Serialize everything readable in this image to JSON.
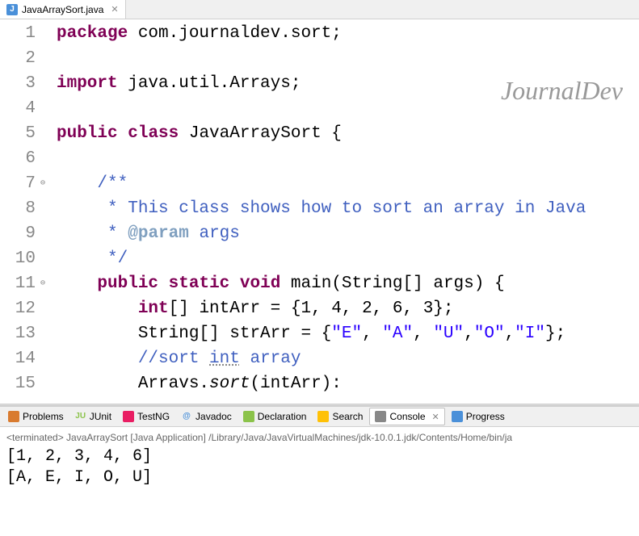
{
  "tab": {
    "filename": "JavaArraySort.java"
  },
  "watermark": "JournalDev",
  "code": {
    "lines": [
      {
        "num": "1",
        "raw": "package com.journaldev.sort;",
        "tokens": [
          [
            "kw",
            "package"
          ],
          [
            "plain",
            " com.journaldev.sort;"
          ]
        ]
      },
      {
        "num": "2",
        "raw": "",
        "tokens": []
      },
      {
        "num": "3",
        "raw": "import java.util.Arrays;",
        "tokens": [
          [
            "kw",
            "import"
          ],
          [
            "plain",
            " java.util.Arrays;"
          ]
        ]
      },
      {
        "num": "4",
        "raw": "",
        "tokens": []
      },
      {
        "num": "5",
        "raw": "public class JavaArraySort {",
        "tokens": [
          [
            "kw",
            "public"
          ],
          [
            "plain",
            " "
          ],
          [
            "kw",
            "class"
          ],
          [
            "plain",
            " JavaArraySort {"
          ]
        ]
      },
      {
        "num": "6",
        "raw": "",
        "highlight": true,
        "tokens": []
      },
      {
        "num": "7",
        "raw": "    /**",
        "fold": true,
        "tokens": [
          [
            "plain",
            "    "
          ],
          [
            "comment",
            "/**"
          ]
        ]
      },
      {
        "num": "8",
        "raw": "     * This class shows how to sort an array in Java",
        "tokens": [
          [
            "plain",
            "     "
          ],
          [
            "comment",
            "* This class shows how to sort an array in Java"
          ]
        ]
      },
      {
        "num": "9",
        "raw": "     * @param args",
        "tokens": [
          [
            "plain",
            "     "
          ],
          [
            "comment",
            "* "
          ],
          [
            "tag",
            "@param"
          ],
          [
            "comment",
            " args"
          ]
        ]
      },
      {
        "num": "10",
        "raw": "     */",
        "tokens": [
          [
            "plain",
            "     "
          ],
          [
            "comment",
            "*/"
          ]
        ]
      },
      {
        "num": "11",
        "raw": "    public static void main(String[] args) {",
        "fold": true,
        "tokens": [
          [
            "plain",
            "    "
          ],
          [
            "kw",
            "public"
          ],
          [
            "plain",
            " "
          ],
          [
            "kw",
            "static"
          ],
          [
            "plain",
            " "
          ],
          [
            "kw",
            "void"
          ],
          [
            "plain",
            " main(String[] args) {"
          ]
        ]
      },
      {
        "num": "12",
        "raw": "        int[] intArr = {1, 4, 2, 6, 3};",
        "tokens": [
          [
            "plain",
            "        "
          ],
          [
            "kw",
            "int"
          ],
          [
            "plain",
            "[] intArr = {1, 4, 2, 6, 3};"
          ]
        ]
      },
      {
        "num": "13",
        "raw": "        String[] strArr = {\"E\", \"A\", \"U\",\"O\",\"I\"};",
        "tokens": [
          [
            "plain",
            "        String[] strArr = {"
          ],
          [
            "str",
            "\"E\""
          ],
          [
            "plain",
            ", "
          ],
          [
            "str",
            "\"A\""
          ],
          [
            "plain",
            ", "
          ],
          [
            "str",
            "\"U\""
          ],
          [
            "plain",
            ","
          ],
          [
            "str",
            "\"O\""
          ],
          [
            "plain",
            ","
          ],
          [
            "str",
            "\"I\""
          ],
          [
            "plain",
            "};"
          ]
        ]
      },
      {
        "num": "14",
        "raw": "        //sort int array",
        "tokens": [
          [
            "plain",
            "        "
          ],
          [
            "comment",
            "//sort "
          ],
          [
            "hint",
            "int"
          ],
          [
            "comment",
            " array"
          ]
        ]
      },
      {
        "num": "15",
        "raw": "        Arrays.sort(intArr);",
        "tokens": [
          [
            "plain",
            "        Arravs."
          ],
          [
            "italic",
            "sort"
          ],
          [
            "plain",
            "(intArr):"
          ]
        ]
      }
    ]
  },
  "views": [
    {
      "label": "Problems",
      "icon_color": "#d97b2f"
    },
    {
      "label": "JUnit",
      "icon_color": "#8bc34a",
      "prefix": "JU"
    },
    {
      "label": "TestNG",
      "icon_color": "#e91e63"
    },
    {
      "label": "Javadoc",
      "icon_color": "#4a90d9",
      "prefix": "@"
    },
    {
      "label": "Declaration",
      "icon_color": "#8bc34a"
    },
    {
      "label": "Search",
      "icon_color": "#ffc107"
    },
    {
      "label": "Console",
      "icon_color": "#888",
      "active": true
    },
    {
      "label": "Progress",
      "icon_color": "#4a90d9"
    }
  ],
  "console": {
    "status": "<terminated> JavaArraySort [Java Application] /Library/Java/JavaVirtualMachines/jdk-10.0.1.jdk/Contents/Home/bin/ja",
    "output": [
      "[1, 2, 3, 4, 6]",
      "[A, E, I, O, U]"
    ]
  }
}
